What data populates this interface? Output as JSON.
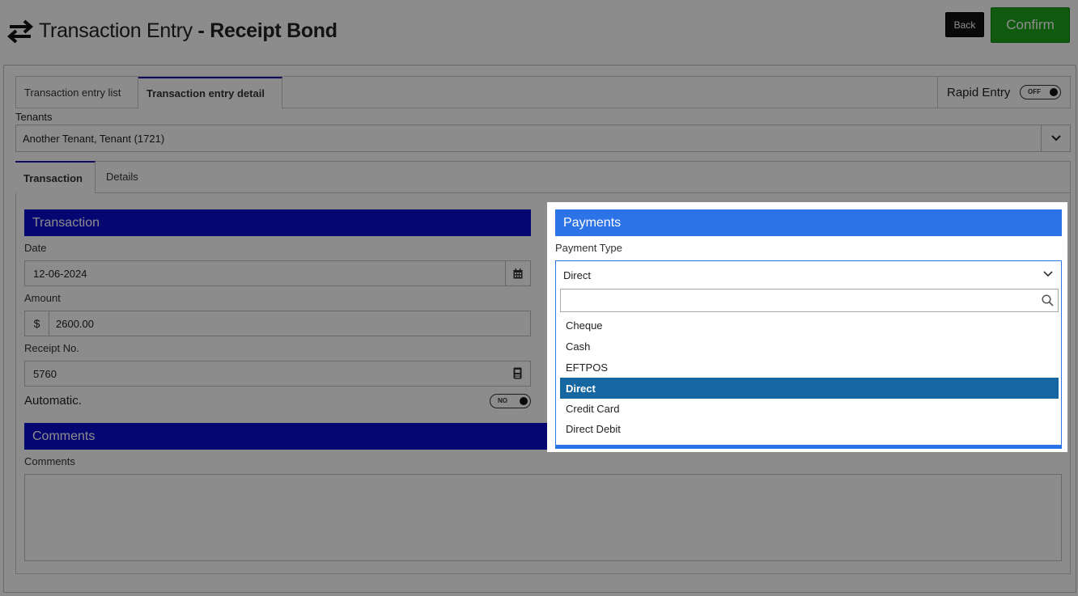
{
  "header": {
    "title_main": "Transaction Entry",
    "title_sub": "- Receipt Bond",
    "icon": "swap-arrows-icon",
    "back_label": "Back",
    "confirm_label": "Confirm",
    "confirm_color": "#1ea51e"
  },
  "top_tabs": [
    {
      "label": "Transaction entry list"
    },
    {
      "label": "Transaction entry detail",
      "active": true
    }
  ],
  "rapid_entry": {
    "label": "Rapid Entry",
    "toggle": "OFF"
  },
  "tenants": {
    "label": "Tenants",
    "value": "Another Tenant, Tenant (1721)"
  },
  "inner_tabs": [
    {
      "label": "Transaction",
      "active": true
    },
    {
      "label": "Details"
    }
  ],
  "transaction": {
    "heading": "Transaction",
    "date_label": "Date",
    "date_value": "12-06-2024",
    "amount_label": "Amount",
    "currency_symbol": "$",
    "amount_value": "2600.00",
    "receipt_label": "Receipt No.",
    "receipt_value": "5760",
    "automatic_label": "Automatic.",
    "automatic_toggle": "NO"
  },
  "payments": {
    "heading": "Payments",
    "type_label": "Payment Type",
    "type_value": "Direct",
    "search_placeholder": "",
    "options": [
      "Cheque",
      "Cash",
      "EFTPOS",
      "Direct",
      "Credit Card",
      "Direct Debit"
    ],
    "selected_index": 3
  },
  "comments": {
    "heading": "Comments",
    "label": "Comments",
    "value": ""
  },
  "colors": {
    "section_dark_blue": "#0b0bd0",
    "section_highlight_blue": "#2b73e6",
    "selected_option": "#1467a0"
  }
}
